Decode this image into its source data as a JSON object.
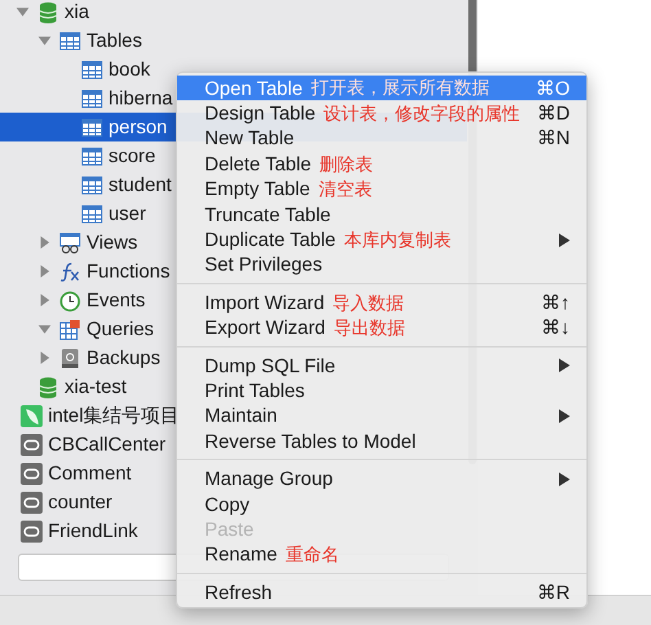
{
  "tree": [
    {
      "label": "xia",
      "kind": "database",
      "expanded": true,
      "selected": false,
      "children": [
        {
          "label": "Tables",
          "kind": "tables",
          "expanded": true,
          "selected": false,
          "children": [
            {
              "label": "book",
              "kind": "table",
              "selected": false
            },
            {
              "label": "hiberna",
              "kind": "table",
              "selected": false
            },
            {
              "label": "person",
              "kind": "table",
              "selected": true
            },
            {
              "label": "score",
              "kind": "table",
              "selected": false
            },
            {
              "label": "student",
              "kind": "table",
              "selected": false
            },
            {
              "label": "user",
              "kind": "table",
              "selected": false
            }
          ]
        },
        {
          "label": "Views",
          "kind": "views",
          "expanded": false,
          "selected": false
        },
        {
          "label": "Functions",
          "kind": "functions",
          "expanded": false,
          "selected": false
        },
        {
          "label": "Events",
          "kind": "events",
          "expanded": false,
          "selected": false
        },
        {
          "label": "Queries",
          "kind": "queries",
          "expanded": true,
          "selected": false
        },
        {
          "label": "Backups",
          "kind": "backups",
          "expanded": false,
          "selected": false
        }
      ]
    },
    {
      "label": "xia-test",
      "kind": "database",
      "selected": false
    }
  ],
  "connections": [
    {
      "label": "intel集结号项目",
      "kind": "app",
      "selected": false
    },
    {
      "label": "CBCallCenter",
      "kind": "connection",
      "selected": false
    },
    {
      "label": "Comment",
      "kind": "connection",
      "selected": false
    },
    {
      "label": "counter",
      "kind": "connection",
      "selected": false
    },
    {
      "label": "FriendLink",
      "kind": "connection",
      "selected": false
    }
  ],
  "menu": {
    "groups": [
      [
        {
          "label": "Open Table",
          "annotation": "打开表，展示所有数据",
          "shortcut": "⌘O",
          "submenu": false,
          "disabled": false,
          "selected": true
        },
        {
          "label": "Design Table",
          "annotation": "设计表，修改字段的属性",
          "shortcut": "⌘D",
          "submenu": false,
          "disabled": false,
          "selected": false
        },
        {
          "label": "New Table",
          "shortcut": "⌘N",
          "submenu": false,
          "disabled": false,
          "selected": false
        },
        {
          "label": "Delete Table",
          "annotation": "删除表",
          "submenu": false,
          "disabled": false,
          "selected": false
        },
        {
          "label": "Empty Table",
          "annotation": "清空表",
          "submenu": false,
          "disabled": false,
          "selected": false
        },
        {
          "label": "Truncate Table",
          "submenu": false,
          "disabled": false,
          "selected": false
        },
        {
          "label": "Duplicate Table",
          "annotation": "本库内复制表",
          "submenu": true,
          "disabled": false,
          "selected": false
        },
        {
          "label": "Set Privileges",
          "submenu": false,
          "disabled": false,
          "selected": false
        }
      ],
      [
        {
          "label": "Import Wizard",
          "annotation": "导入数据",
          "shortcut": "⌘↑",
          "submenu": false,
          "disabled": false,
          "selected": false
        },
        {
          "label": "Export Wizard",
          "annotation": "导出数据",
          "shortcut": "⌘↓",
          "submenu": false,
          "disabled": false,
          "selected": false
        }
      ],
      [
        {
          "label": "Dump SQL File",
          "submenu": true,
          "disabled": false,
          "selected": false
        },
        {
          "label": "Print Tables",
          "submenu": false,
          "disabled": false,
          "selected": false
        },
        {
          "label": "Maintain",
          "submenu": true,
          "disabled": false,
          "selected": false
        },
        {
          "label": "Reverse Tables to Model",
          "submenu": false,
          "disabled": false,
          "selected": false
        }
      ],
      [
        {
          "label": "Manage Group",
          "submenu": true,
          "disabled": false,
          "selected": false
        },
        {
          "label": "Copy",
          "submenu": false,
          "disabled": false,
          "selected": false
        },
        {
          "label": "Paste",
          "submenu": false,
          "disabled": true,
          "selected": false
        },
        {
          "label": "Rename",
          "annotation": "重命名",
          "submenu": false,
          "disabled": false,
          "selected": false
        }
      ],
      [
        {
          "label": "Refresh",
          "shortcut": "⌘R",
          "submenu": false,
          "disabled": false,
          "selected": false
        }
      ]
    ]
  }
}
